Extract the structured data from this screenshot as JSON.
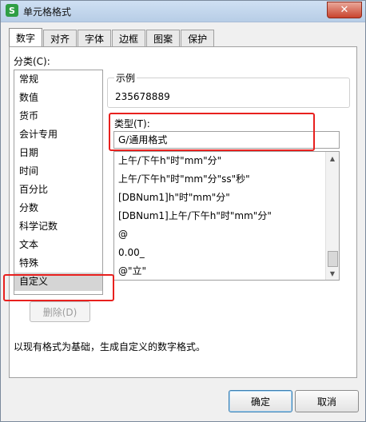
{
  "window": {
    "title": "单元格格式",
    "app_icon_letter": "S",
    "close_glyph": "✕"
  },
  "tabs": [
    "数字",
    "对齐",
    "字体",
    "边框",
    "图案",
    "保护"
  ],
  "category": {
    "label": "分类(C):",
    "items": [
      "常规",
      "数值",
      "货币",
      "会计专用",
      "日期",
      "时间",
      "百分比",
      "分数",
      "科学记数",
      "文本",
      "特殊",
      "自定义"
    ],
    "selected": "自定义"
  },
  "sample": {
    "title": "示例",
    "value": "235678889"
  },
  "type": {
    "label": "类型(T):",
    "value": "G/通用格式",
    "list": [
      "上午/下午h\"时\"mm\"分\"",
      "上午/下午h\"时\"mm\"分\"ss\"秒\"",
      "[DBNum1]h\"时\"mm\"分\"",
      "[DBNum1]上午/下午h\"时\"mm\"分\"",
      "@",
      "0.00_",
      "@\"立\""
    ]
  },
  "delete_button": "删除(D)",
  "description": "以现有格式为基础，生成自定义的数字格式。",
  "footer": {
    "ok": "确定",
    "cancel": "取消"
  },
  "colors": {
    "highlight": "#e8201e",
    "selected_item": "#d5d5d5"
  }
}
